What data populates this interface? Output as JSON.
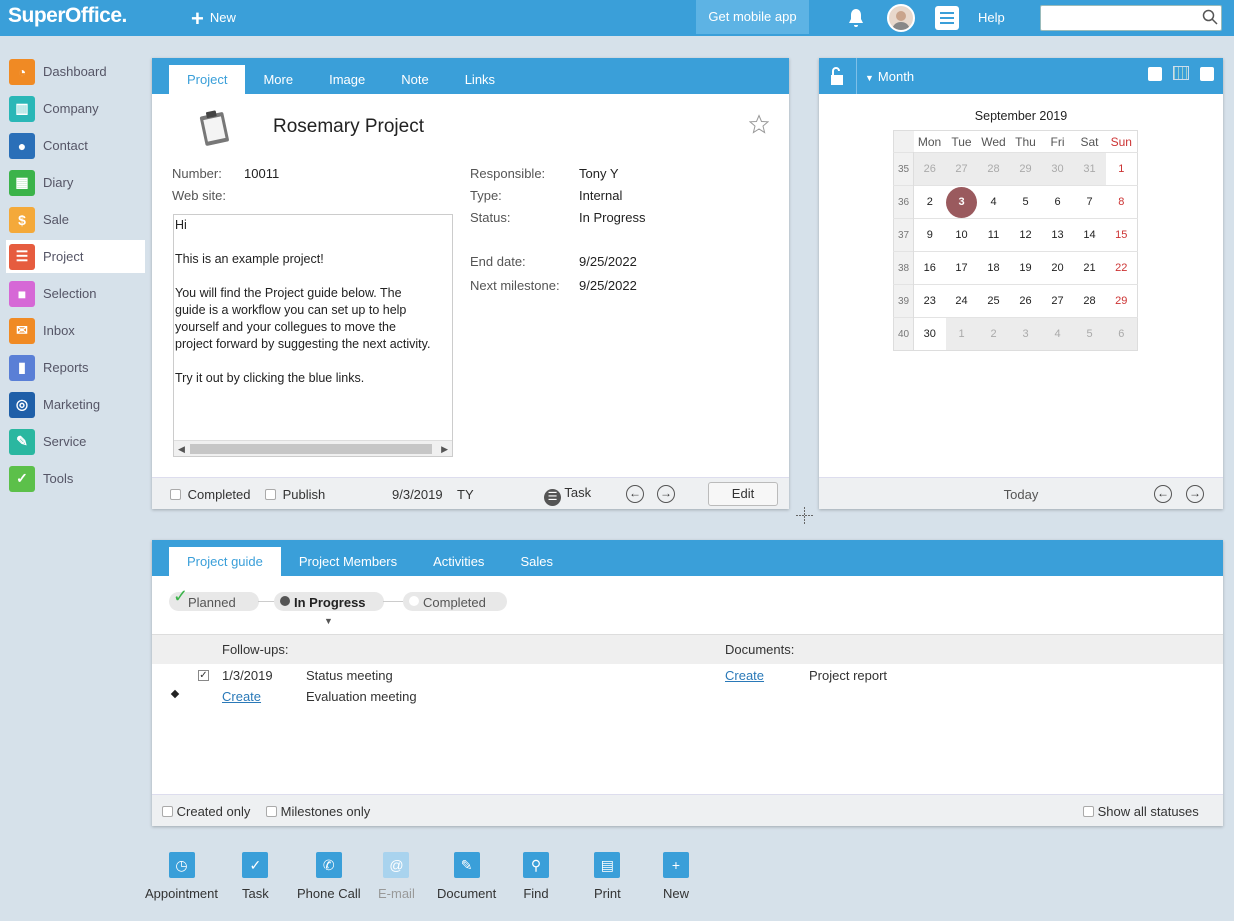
{
  "brand": {
    "logo": "SuperOffice.",
    "accent": "#3a9fd9"
  },
  "topbar": {
    "new_label": "New",
    "mobile_label": "Get mobile app",
    "help_label": "Help",
    "search_value": ""
  },
  "sidebar": {
    "items": [
      {
        "label": "Dashboard",
        "icon": "dashboard-icon",
        "color": "#f08a24"
      },
      {
        "label": "Company",
        "icon": "company-icon",
        "color": "#2ab7b7"
      },
      {
        "label": "Contact",
        "icon": "contact-icon",
        "color": "#2a6fb8"
      },
      {
        "label": "Diary",
        "icon": "diary-icon",
        "color": "#3bb34a"
      },
      {
        "label": "Sale",
        "icon": "sale-icon",
        "color": "#f4a93a"
      },
      {
        "label": "Project",
        "icon": "project-icon",
        "color": "#e65c3f"
      },
      {
        "label": "Selection",
        "icon": "selection-icon",
        "color": "#d668d6"
      },
      {
        "label": "Inbox",
        "icon": "inbox-icon",
        "color": "#f08a24"
      },
      {
        "label": "Reports",
        "icon": "reports-icon",
        "color": "#5a7fd6"
      },
      {
        "label": "Marketing",
        "icon": "marketing-icon",
        "color": "#1f5fa8"
      },
      {
        "label": "Service",
        "icon": "service-icon",
        "color": "#2ab7a0"
      },
      {
        "label": "Tools",
        "icon": "tools-icon",
        "color": "#5cc04a"
      }
    ],
    "active": "Project"
  },
  "project": {
    "tabs": [
      "Project",
      "More",
      "Image",
      "Note",
      "Links"
    ],
    "title": "Rosemary Project",
    "number_label": "Number:",
    "number": "10011",
    "website_label": "Web site:",
    "responsible_label": "Responsible:",
    "responsible": "Tony Y",
    "type_label": "Type:",
    "type": "Internal",
    "status_label": "Status:",
    "status": "In Progress",
    "end_label": "End date:",
    "end": "9/25/2022",
    "milestone_label": "Next milestone:",
    "milestone": "9/25/2022",
    "note": {
      "l1": "Hi",
      "l2": "This is an example project!",
      "l3": "You will find the Project guide below. The",
      "l4": "guide is a workflow you can set up to help",
      "l5": "yourself and your collegues to move the",
      "l6": "project forward by suggesting the next activity.",
      "l7": "Try it out by clicking the blue links."
    },
    "footer": {
      "completed": "Completed",
      "publish": "Publish",
      "date": "9/3/2019",
      "user": "TY",
      "task": "Task",
      "edit": "Edit"
    }
  },
  "calendar": {
    "view": "Month",
    "title": "September 2019",
    "days": [
      "Mon",
      "Tue",
      "Wed",
      "Thu",
      "Fri",
      "Sat",
      "Sun"
    ],
    "today": "Today",
    "weeks": [
      {
        "wk": "35",
        "d": [
          "26",
          "27",
          "28",
          "29",
          "30",
          "31",
          "1"
        ]
      },
      {
        "wk": "36",
        "d": [
          "2",
          "3",
          "4",
          "5",
          "6",
          "7",
          "8"
        ]
      },
      {
        "wk": "37",
        "d": [
          "9",
          "10",
          "11",
          "12",
          "13",
          "14",
          "15"
        ]
      },
      {
        "wk": "38",
        "d": [
          "16",
          "17",
          "18",
          "19",
          "20",
          "21",
          "22"
        ]
      },
      {
        "wk": "39",
        "d": [
          "23",
          "24",
          "25",
          "26",
          "27",
          "28",
          "29"
        ]
      },
      {
        "wk": "40",
        "d": [
          "30",
          "1",
          "2",
          "3",
          "4",
          "5",
          "6"
        ]
      }
    ],
    "selected": "3"
  },
  "guide": {
    "tabs": [
      "Project guide",
      "Project Members",
      "Activities",
      "Sales"
    ],
    "stages": [
      "Planned",
      "In Progress",
      "Completed"
    ],
    "followups_label": "Follow-ups:",
    "documents_label": "Documents:",
    "row1": {
      "date": "1/3/2019",
      "text": "Status meeting"
    },
    "row2": {
      "link": "Create",
      "text": "Evaluation meeting"
    },
    "doc": {
      "link": "Create",
      "text": "Project report"
    },
    "footer": {
      "created": "Created only",
      "milestones": "Milestones only",
      "all": "Show all statuses"
    }
  },
  "bottom": [
    {
      "label": "Appointment",
      "icon": "clock-icon"
    },
    {
      "label": "Task",
      "icon": "check-icon"
    },
    {
      "label": "Phone Call",
      "icon": "phone-icon"
    },
    {
      "label": "E-mail",
      "icon": "at-icon"
    },
    {
      "label": "Document",
      "icon": "pencil-icon"
    },
    {
      "label": "Find",
      "icon": "magnifier-icon"
    },
    {
      "label": "Print",
      "icon": "printer-icon"
    },
    {
      "label": "New",
      "icon": "plus-icon"
    }
  ]
}
